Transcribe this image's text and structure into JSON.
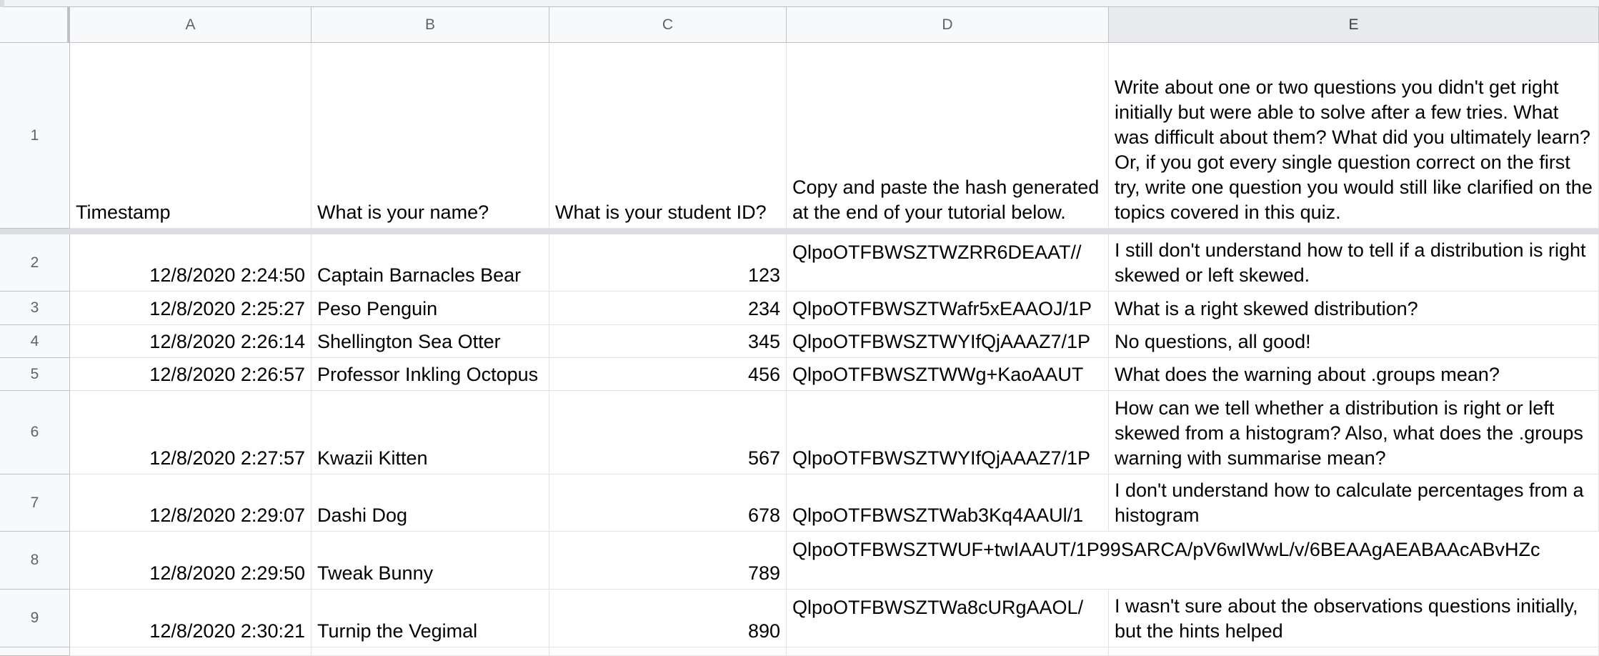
{
  "columns": [
    "A",
    "B",
    "C",
    "D",
    "E"
  ],
  "header_row": {
    "row_label": "1",
    "cells": [
      "Timestamp",
      "What is your name?",
      "What is your student ID?",
      "Copy and paste the hash generated at the end of your tutorial below.",
      "Write about one or two questions you didn't get right initially but were able to solve after a few tries. What was difficult about them? What did you ultimately learn? Or, if you got every single question correct on the first try, write one question you would still like clarified on the topics covered in this quiz."
    ]
  },
  "rows": [
    {
      "label": "2",
      "timestamp": "12/8/2020 2:24:50",
      "name": "Captain Barnacles Bear",
      "id": "123",
      "hash": "QlpoOTFBWSZTWZRR6DEAAT//",
      "response": "I still don't understand how to tell if a distribution is right skewed or left skewed."
    },
    {
      "label": "3",
      "timestamp": "12/8/2020 2:25:27",
      "name": "Peso Penguin",
      "id": "234",
      "hash": "QlpoOTFBWSZTWafr5xEAAOJ/1P",
      "response": "What is a right skewed distribution?"
    },
    {
      "label": "4",
      "timestamp": "12/8/2020 2:26:14",
      "name": "Shellington Sea Otter",
      "id": "345",
      "hash": "QlpoOTFBWSZTWYIfQjAAAZ7/1P",
      "response": "No questions, all good!"
    },
    {
      "label": "5",
      "timestamp": "12/8/2020 2:26:57",
      "name": "Professor Inkling Octopus",
      "id": "456",
      "hash": "QlpoOTFBWSZTWWg+KaoAAUT",
      "response": "What does the warning about .groups mean?"
    },
    {
      "label": "6",
      "timestamp": "12/8/2020 2:27:57",
      "name": "Kwazii Kitten",
      "id": "567",
      "hash": "QlpoOTFBWSZTWYIfQjAAAZ7/1P",
      "response": "How can we tell whether a distribution is right or left skewed from a histogram? Also, what does the .groups warning with summarise mean?"
    },
    {
      "label": "7",
      "timestamp": "12/8/2020 2:29:07",
      "name": "Dashi Dog",
      "id": "678",
      "hash": "QlpoOTFBWSZTWab3Kq4AAUl/1",
      "response": "I don't understand how to calculate percentages from a histogram"
    },
    {
      "label": "8",
      "timestamp": "12/8/2020 2:29:50",
      "name": "Tweak Bunny",
      "id": "789",
      "hash": "QlpoOTFBWSZTWUF+twIAAUT/1P99SARCA/pV6wIWwL/v/6BEAAgAEABAAcABvHZc",
      "response": ""
    },
    {
      "label": "9",
      "timestamp": "12/8/2020 2:30:21",
      "name": "Turnip the Vegimal",
      "id": "890",
      "hash": "QlpoOTFBWSZTWa8cURgAAOL/",
      "response": "I wasn't sure about the observations questions initially, but the hints helped"
    }
  ],
  "colors": {
    "header_bg": "#f8f9fa",
    "selected_header_bg": "#e8eaed",
    "gridline": "#e2e3e3",
    "freeze_bar": "#dadce0"
  }
}
